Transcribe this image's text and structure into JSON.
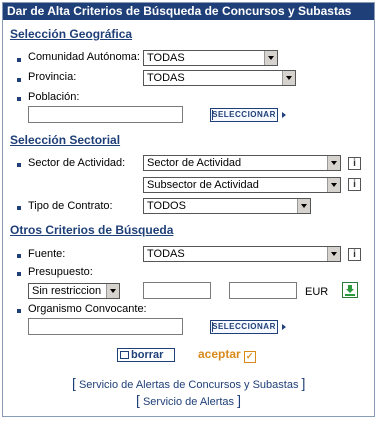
{
  "window": {
    "title": "Dar de Alta Criterios de Búsqueda de Concursos y Subastas"
  },
  "geografica": {
    "heading": "Selección Geográfica",
    "comunidad_label": "Comunidad Autónoma:",
    "comunidad_value": "TODAS",
    "provincia_label": "Provincia:",
    "provincia_value": "TODAS",
    "poblacion_label": "Población:",
    "poblacion_value": "",
    "seleccionar_label": "SELECCIONAR"
  },
  "sectorial": {
    "heading": "Selección Sectorial",
    "sector_label": "Sector de Actividad:",
    "sector_value": "Sector de Actividad",
    "subsector_value": "Subsector de Actividad",
    "tipo_label": "Tipo de Contrato:",
    "tipo_value": "TODOS"
  },
  "otros": {
    "heading": "Otros Criterios de Búsqueda",
    "fuente_label": "Fuente:",
    "fuente_value": "TODAS",
    "presupuesto_label": "Presupuesto:",
    "presupuesto_select": "Sin restriccion",
    "presupuesto_min": "",
    "presupuesto_max": "",
    "currency": "EUR",
    "organismo_label": "Organismo Convocante:",
    "organismo_value": "",
    "seleccionar_label": "SELECCIONAR"
  },
  "actions": {
    "borrar": "borrar",
    "aceptar": "aceptar"
  },
  "footer": {
    "link1": "Servicio de Alertas de Concursos y Subastas",
    "link2": "Servicio de Alertas"
  },
  "icons": {
    "info": "i"
  }
}
